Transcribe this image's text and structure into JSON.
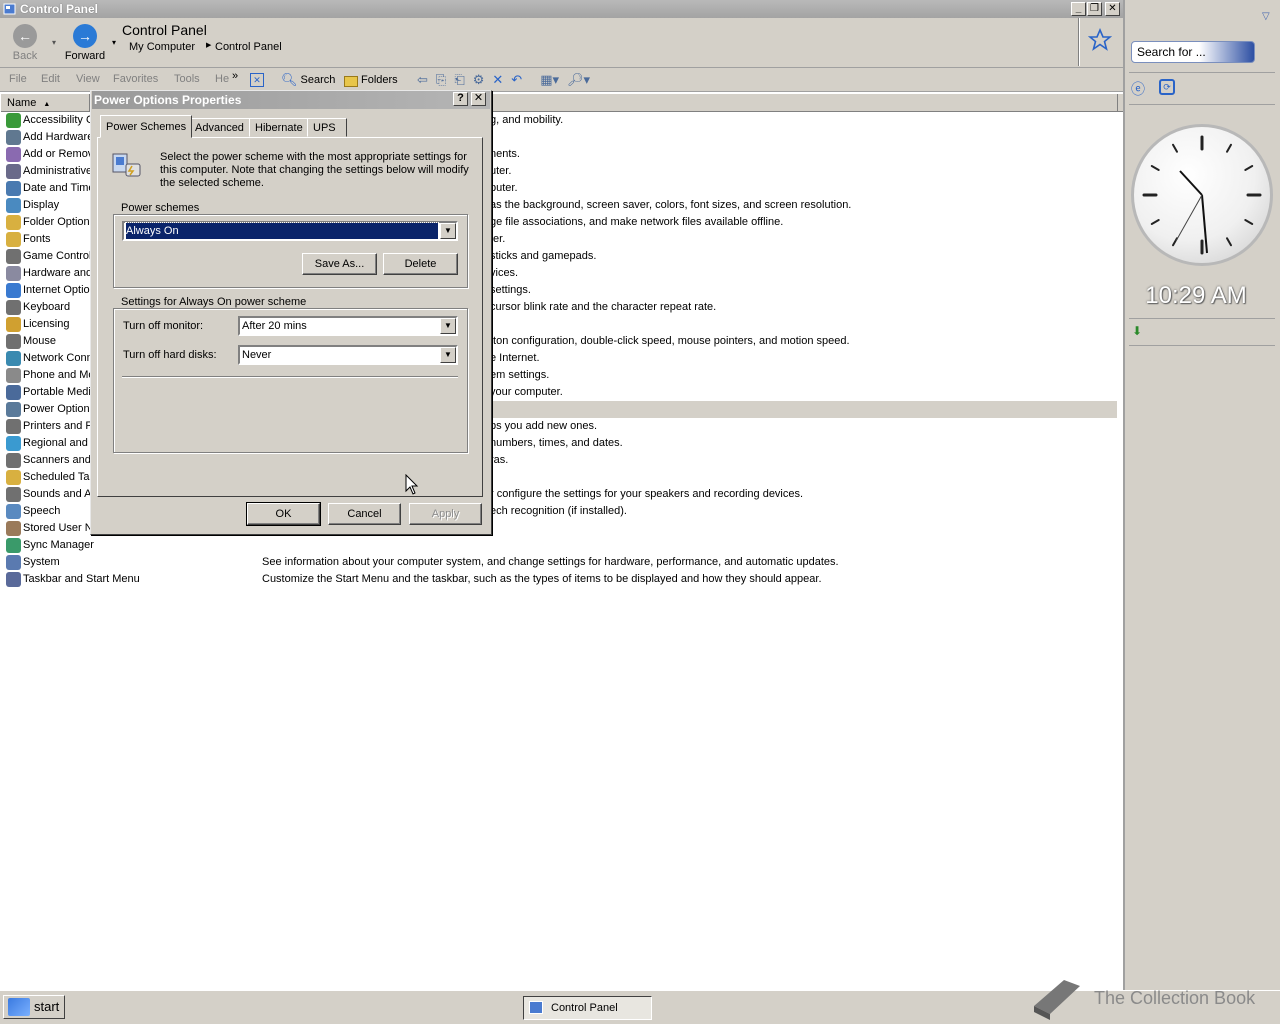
{
  "window": {
    "title": "Control Panel"
  },
  "nav": {
    "back_label": "Back",
    "forward_label": "Forward",
    "location_title": "Control Panel",
    "breadcrumb": [
      "My Computer",
      "Control Panel"
    ]
  },
  "menu": [
    "File",
    "Edit",
    "View",
    "Favorites",
    "Tools",
    "He"
  ],
  "toolbar": {
    "search_label": "Search",
    "folders_label": "Folders"
  },
  "list": {
    "column_name": "Name",
    "items": [
      "Accessibility Options",
      "Add Hardware",
      "Add or Remove Programs",
      "Administrative Tools",
      "Date and Time",
      "Display",
      "Folder Options",
      "Fonts",
      "Game Controllers",
      "Hardware and Sound",
      "Internet Options",
      "Keyboard",
      "Licensing",
      "Mouse",
      "Network Connections",
      "Phone and Modem Options",
      "Portable Media Devices",
      "Power Options",
      "Printers and Faxes",
      "Regional and Language Options",
      "Scanners and Cameras",
      "Scheduled Tasks",
      "Sounds and Audio Devices",
      "Speech",
      "Stored User Names and Passwords",
      "Sync Manager",
      "System",
      "Taskbar and Start Menu"
    ],
    "descriptions": [
      "g, and mobility.",
      "",
      "nents.",
      "uter.",
      "puter.",
      "as the background, screen saver, colors, font sizes, and screen resolution.",
      "ge file associations, and make network files available offline.",
      "ter.",
      "sticks and gamepads.",
      "vices.",
      "settings.",
      "cursor blink rate and the character repeat rate.",
      "",
      "tton configuration, double-click speed, mouse pointers, and motion speed.",
      "e Internet.",
      "em settings.",
      "your computer.",
      "uter.",
      "ps you add new ones.",
      " numbers, times, and dates.",
      "ras.",
      "",
      "r configure the settings for your speakers and recording devices.",
      "ech recognition (if installed).",
      ".",
      "",
      "See information about your computer system, and change settings for hardware, performance, and automatic updates.",
      "Customize the Start Menu and the taskbar, such as the types of items to be displayed and how they should appear."
    ]
  },
  "sidebar": {
    "search_placeholder": "Search for ...",
    "time": "10:29 AM"
  },
  "taskbar": {
    "start_label": "start",
    "task_label": "Control Panel",
    "watermark": "The Collection Book"
  },
  "dialog": {
    "title": "Power Options Properties",
    "tabs": [
      "Power Schemes",
      "Advanced",
      "Hibernate",
      "UPS"
    ],
    "intro": "Select the power scheme with the most appropriate settings for this computer. Note that changing the settings below will modify the selected scheme.",
    "schemes_group": "Power schemes",
    "selected_scheme": "Always On",
    "save_as_label": "Save As...",
    "delete_label": "Delete",
    "settings_group": "Settings for Always On power scheme",
    "monitor_label": "Turn off monitor:",
    "monitor_value": "After 20 mins",
    "disks_label": "Turn off hard disks:",
    "disks_value": "Never",
    "ok_label": "OK",
    "cancel_label": "Cancel",
    "apply_label": "Apply"
  },
  "colors": {
    "selection": "#0a246a",
    "chrome": "#d4d0c8",
    "title_inactive": "#a3a3a3"
  }
}
